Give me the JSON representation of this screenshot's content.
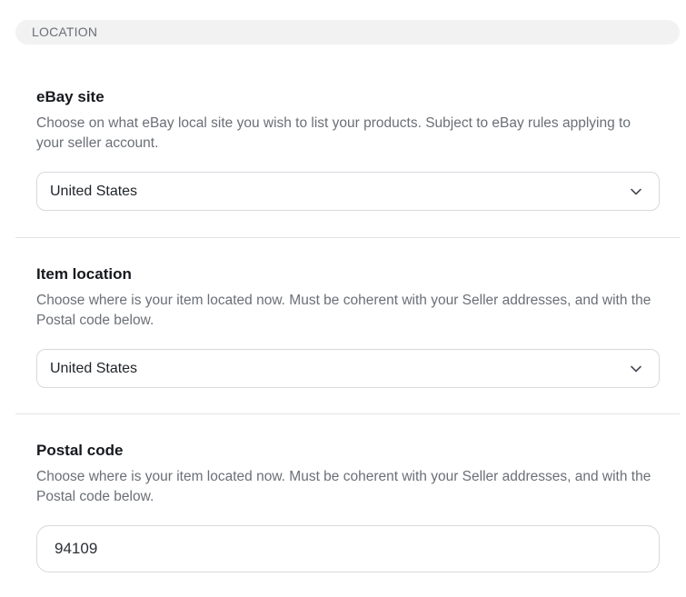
{
  "section": {
    "title": "LOCATION"
  },
  "ebay_site": {
    "label": "eBay site",
    "description": "Choose on what eBay local site you wish to list your products. Subject to eBay rules applying to your seller account.",
    "selected": "United States",
    "icon": "chevron-down-icon"
  },
  "item_location": {
    "label": "Item location",
    "description": "Choose where is your item located now. Must be coherent with your Seller addresses, and with the Postal code below.",
    "selected": "United States",
    "icon": "chevron-down-icon"
  },
  "postal_code": {
    "label": "Postal code",
    "description": "Choose where is your item located now. Must be coherent with your Seller addresses, and with the Postal code below.",
    "value": "94109"
  }
}
